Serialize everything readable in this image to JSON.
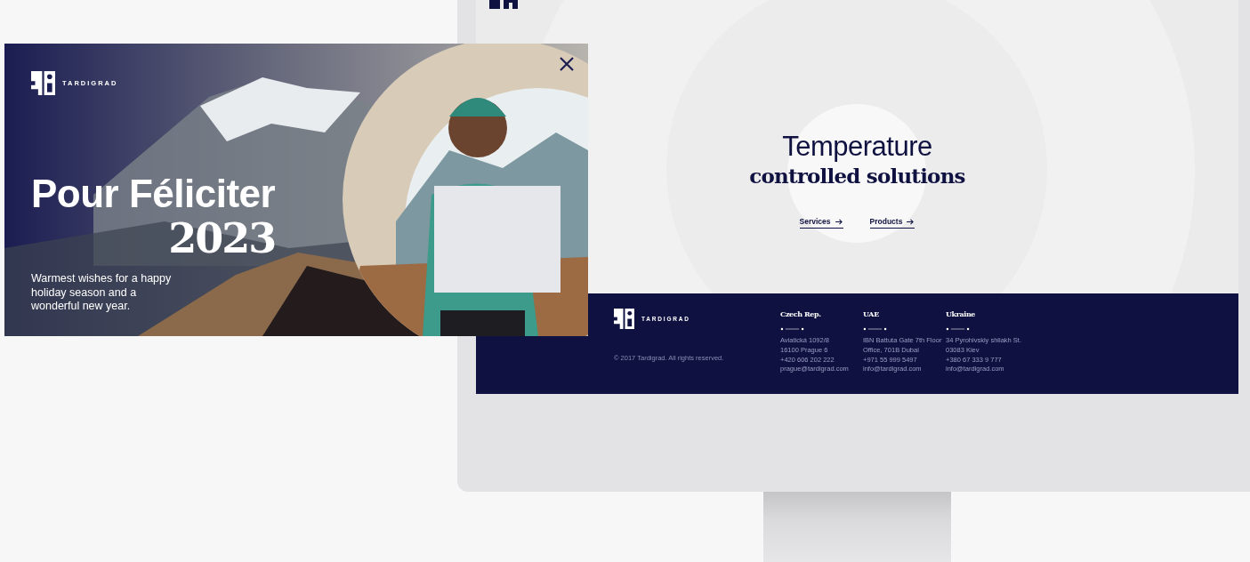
{
  "popup": {
    "brand": "TARDIGRAD",
    "title": "Pour Féliciter",
    "year": "2023",
    "message": "Warmest wishes for a happy holiday season and a wonderful new year."
  },
  "hero": {
    "line_1": "Temperature",
    "line_2": "controlled solutions",
    "links": [
      {
        "label": "Services"
      },
      {
        "label": "Products"
      }
    ]
  },
  "footer": {
    "brand": "TARDIGRAD",
    "copyright": "© 2017 Tardigrad. All rights reserved.",
    "offices": [
      {
        "country": "Czech Rep.",
        "lines": [
          "Aviatická 1092/8",
          "16100 Prague 6",
          "+420 606 202 222",
          "prague@tardigrad.com"
        ]
      },
      {
        "country": "UAE",
        "lines": [
          "IBN Battuta Gate 7th Floor",
          "Office, 701B Dubai",
          "+971 55 999 5497",
          "info@tardigrad.com"
        ]
      },
      {
        "country": "Ukraine",
        "lines": [
          "34 Pyrohivskiy shliakh St.",
          "03083 Kiev",
          "+380 67 333 9 777",
          "info@tardigrad.com"
        ]
      }
    ]
  }
}
